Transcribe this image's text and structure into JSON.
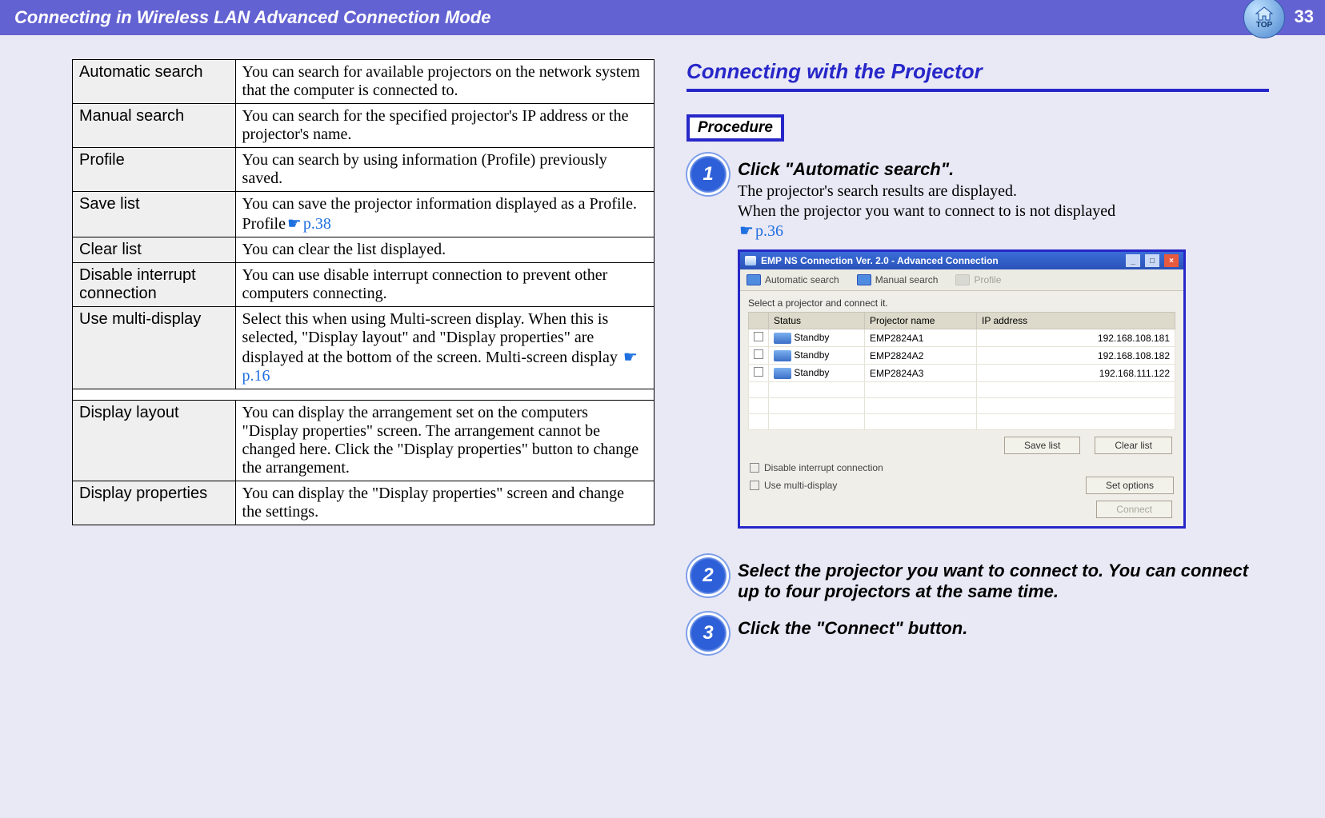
{
  "header": {
    "title": "Connecting in Wireless LAN Advanced Connection Mode",
    "page_number": "33",
    "top_icon_label": "TOP"
  },
  "left_table": {
    "rows_a": [
      {
        "term": "Automatic search",
        "desc": "You can search for available projectors on the network system that the computer is connected to."
      },
      {
        "term": "Manual search",
        "desc": "You can search for the specified projector's IP address or the projector's name."
      },
      {
        "term": "Profile",
        "desc": "You can search by using information (Profile) previously saved."
      },
      {
        "term": "Save list",
        "desc_pre": "You can save the projector information displayed as a Profile. Profile",
        "ref": "p.38"
      },
      {
        "term": "Clear list",
        "desc": "You can clear the list displayed."
      },
      {
        "term": "Disable interrupt connection",
        "desc": "You can use disable interrupt connection to prevent other computers connecting."
      },
      {
        "term": "Use multi-display",
        "desc_pre": "Select this when using Multi-screen display. When this is selected, \"Display layout\" and \"Display properties\" are displayed at the bottom of the screen. Multi-screen display ",
        "ref": "p.16"
      }
    ],
    "rows_b": [
      {
        "term": "Display layout",
        "desc": "You can display the arrangement set on the computers \"Display properties\" screen. The arrangement cannot be changed here. Click the \"Display properties\" button to change the arrangement."
      },
      {
        "term": "Display properties",
        "desc": "You can display the \"Display properties\" screen and change the settings."
      }
    ]
  },
  "right": {
    "section_title": "Connecting with the Projector",
    "procedure_label": "Procedure",
    "steps": [
      {
        "num": "1",
        "title": "Click \"Automatic search\".",
        "body_pre": "The projector's search results are displayed.\nWhen the projector you want to connect to is not displayed ",
        "ref": "p.36"
      },
      {
        "num": "2",
        "title": "Select the projector you want to connect to. You can connect up to four projectors at the same time."
      },
      {
        "num": "3",
        "title": "Click the \"Connect\" button."
      }
    ],
    "app": {
      "title": "EMP NS Connection Ver. 2.0 - Advanced Connection",
      "toolbar": {
        "auto": "Automatic search",
        "manual": "Manual search",
        "profile": "Profile"
      },
      "instruction": "Select a projector and connect it.",
      "columns": {
        "c0": "",
        "c1": "Status",
        "c2": "Projector name",
        "c3": "IP address"
      },
      "rows": [
        {
          "status": "Standby",
          "name": "EMP2824A1",
          "ip": "192.168.108.181"
        },
        {
          "status": "Standby",
          "name": "EMP2824A2",
          "ip": "192.168.108.182"
        },
        {
          "status": "Standby",
          "name": "EMP2824A3",
          "ip": "192.168.111.122"
        }
      ],
      "save_btn": "Save list",
      "clear_btn": "Clear list",
      "chk_disable": "Disable interrupt connection",
      "chk_multi": "Use multi-display",
      "set_options_btn": "Set options",
      "connect_btn": "Connect"
    }
  }
}
